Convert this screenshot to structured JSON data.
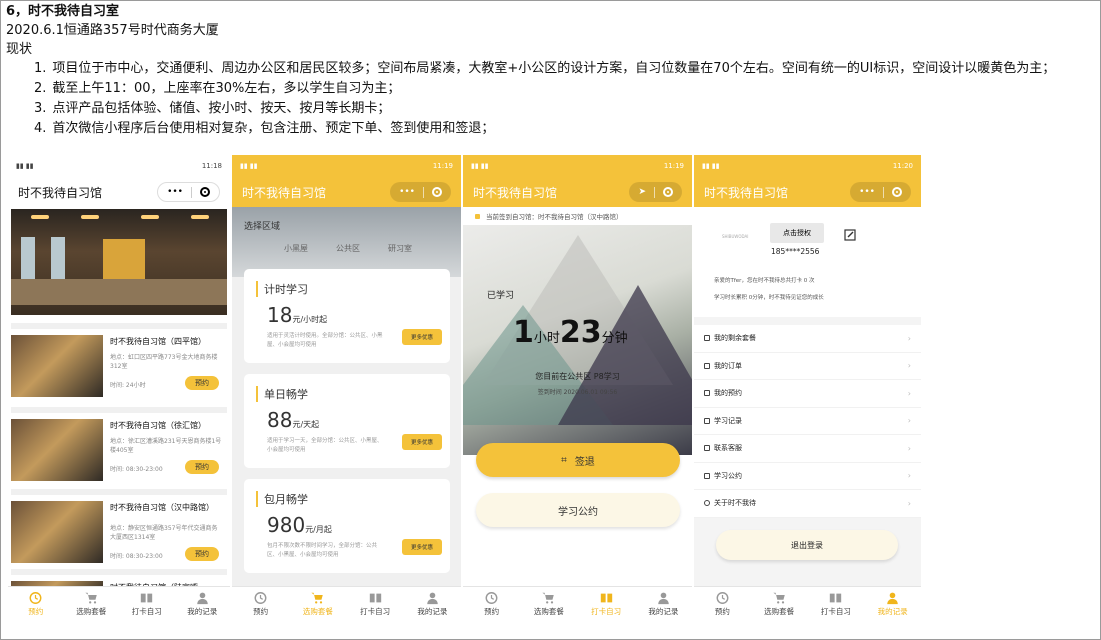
{
  "doc": {
    "heading": "6，时不我待自习室",
    "date_address": "2020.6.1恒通路357号时代商务大厦",
    "section": "现状",
    "items": [
      {
        "n": "1.",
        "text": "项目位于市中心，交通便利、周边办公区和居民区较多；空间布局紧凑，大教室+小公区的设计方案，自习位数量在70个左右。空间有统一的UI标识，空间设计以暖黄色为主；"
      },
      {
        "n": "2.",
        "text": "截至上午11：00，上座率在30%左右，多以学生自习为主；"
      },
      {
        "n": "3.",
        "text": "点评产品包括体验、储值、按小时、按天、按月等长期卡；"
      },
      {
        "n": "4.",
        "text": "首次微信小程序后台使用相对复杂，包含注册、预定下单、签到使用和签退；"
      }
    ]
  },
  "colors": {
    "accent": "#f4c23a",
    "accent_text": "#f0b51c"
  },
  "tabs": [
    {
      "label": "预约",
      "icon": "clock-icon"
    },
    {
      "label": "选购套餐",
      "icon": "cart-icon"
    },
    {
      "label": "打卡自习",
      "icon": "book-icon"
    },
    {
      "label": "我的记录",
      "icon": "user-icon"
    }
  ],
  "phone1": {
    "time": "11:18",
    "title": "时不我待自习馆",
    "stores": [
      {
        "name": "时不我待自习馆（四平馆）",
        "addr": "地点：虹口区四平路773号金大地商务楼312室",
        "hours": "时间: 24小时",
        "btn": "预约"
      },
      {
        "name": "时不我待自习馆（徐汇馆）",
        "addr": "地点：徐汇区漕溪路231号天恩商务楼1号楼405室",
        "hours": "时间: 08:30-23:00",
        "btn": "预约"
      },
      {
        "name": "时不我待自习馆（汉中路馆）",
        "addr": "地点：静安区恒通路357号年代交通商务大厦西区1314室",
        "hours": "时间: 08:30-23:00",
        "btn": "预约"
      },
      {
        "name": "时不我待自习馆（陆家嘴",
        "addr": "",
        "hours": "",
        "btn": ""
      }
    ]
  },
  "phone2": {
    "time": "11:19",
    "title": "时不我待自习馆",
    "region_label": "选择区域",
    "regions": [
      "小黑屋",
      "公共区",
      "研习室"
    ],
    "cards": [
      {
        "title": "计时学习",
        "price": "18",
        "unit": "元/小时起",
        "desc": "适用于灵活计时使用。全部分馆：公共区、小黑屋、小会屋均可使用",
        "more": "更多优惠"
      },
      {
        "title": "单日畅学",
        "price": "88",
        "unit": "元/天起",
        "desc": "适用于学习一天，全部分馆：公共区、小黑屋、小会屋均可使用",
        "more": "更多优惠"
      },
      {
        "title": "包月畅学",
        "price": "980",
        "unit": "元/月起",
        "desc": "包月不限次数不限时间学习，全部分馆：公共区、小黑屋、小会屋均可使用",
        "more": "更多优惠"
      }
    ]
  },
  "phone3": {
    "time": "11:19",
    "title": "时不我待自习馆",
    "banner": "当前签到自习馆：时不我待自习馆（汉中路馆）",
    "studied_label": "已学习",
    "hours": "1",
    "hours_unit": "小时",
    "minutes": "23",
    "minutes_unit": "分钟",
    "location": "您目前在公共区 P8学习",
    "signin_time": "签到时间 2020.06.01 09:56",
    "checkout_btn": "签退",
    "rules_btn": "学习公约"
  },
  "phone4": {
    "time": "11:20",
    "title": "时不我待自习馆",
    "auth_btn": "点击授权",
    "phone": "185****2556",
    "logo_text": "SHIBUWODAI",
    "msg1": "亲爱的Tfer，您在时不我待总共打卡 0 次",
    "msg2": "学习时长累积 0分钟，时不我待见证您的成长",
    "menu": [
      "我的剩余套餐",
      "我的订单",
      "我的预约",
      "学习记录",
      "联系客服",
      "学习公约",
      "关于时不我待"
    ],
    "logout": "退出登录"
  }
}
